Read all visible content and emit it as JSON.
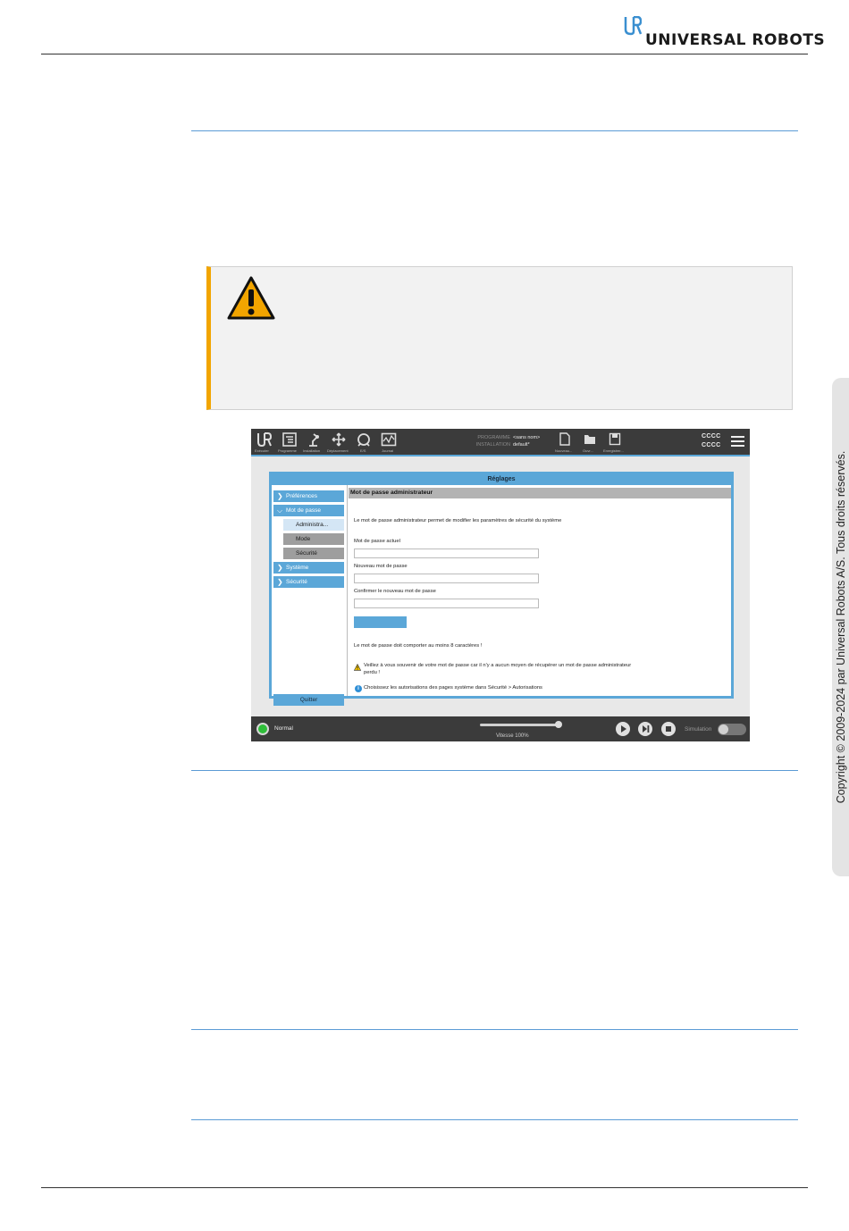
{
  "header": {
    "brand": "UNIVERSAL ROBOTS",
    "brand_color": "#1a1a1a"
  },
  "side_tab": {
    "copyright": "Copyright © 2009-2024 par Universal Robots A/S. Tous droits réservés."
  },
  "warning_box": {
    "icon": "warning-triangle-icon",
    "accent_color": "#f2a500"
  },
  "screenshot": {
    "top_bar": {
      "icons": [
        {
          "icon": "ur-logo-icon",
          "label": "Exécuter"
        },
        {
          "icon": "program-icon",
          "label": "Programme"
        },
        {
          "icon": "installation-icon",
          "label": "Installation"
        },
        {
          "icon": "move-icon",
          "label": "Déplacement"
        },
        {
          "icon": "io-icon",
          "label": "E/S"
        },
        {
          "icon": "log-icon",
          "label": "Journal"
        }
      ],
      "program_key": "PROGRAMME",
      "program_value": "<sans nom>",
      "installation_key": "INSTALLATION",
      "installation_value": "default*",
      "file_actions": [
        {
          "icon": "new-file-icon",
          "label": "Nouveau..."
        },
        {
          "icon": "open-folder-icon",
          "label": "Ouvr..."
        },
        {
          "icon": "save-icon",
          "label": "Enregistrer..."
        }
      ],
      "user_line1": "CCCC",
      "user_line2": "CCCC",
      "menu_icon": "hamburger-menu-icon"
    },
    "dialog": {
      "title": "Réglages",
      "nav": {
        "preferences": "Préférences",
        "password": "Mot de passe",
        "sub_admin": "Administra...",
        "sub_mode": "Mode",
        "sub_security": "Sécurité",
        "system": "Système",
        "safety": "Sécurité",
        "quit": "Quitter"
      },
      "content": {
        "heading": "Mot de passe administrateur",
        "intro": "Le mot de passe administrateur permet de modifier les paramètres de sécurité du système",
        "current_label": "Mot de passe actuel",
        "new_label": "Nouveau mot de passe",
        "confirm_label": "Confirmer le nouveau mot de passe",
        "rule": "Le mot de passe doit comporter au moins 8 caractères !",
        "warn_line1": "Veillez à vous souvenir de votre mot de passe car il n'y a aucun moyen de récupérer un mot de passe administrateur",
        "warn_line2": "perdu !",
        "info": "Choisissez les autorisations des pages système dans Sécurité > Autorisations"
      }
    },
    "bottom_bar": {
      "status": "Normal",
      "status_color": "#2fbe3a",
      "speed": "Vitesse 100%",
      "speed_fraction": 1.0,
      "simulation": "Simulation"
    },
    "accent_color": "#5ba7d8"
  }
}
